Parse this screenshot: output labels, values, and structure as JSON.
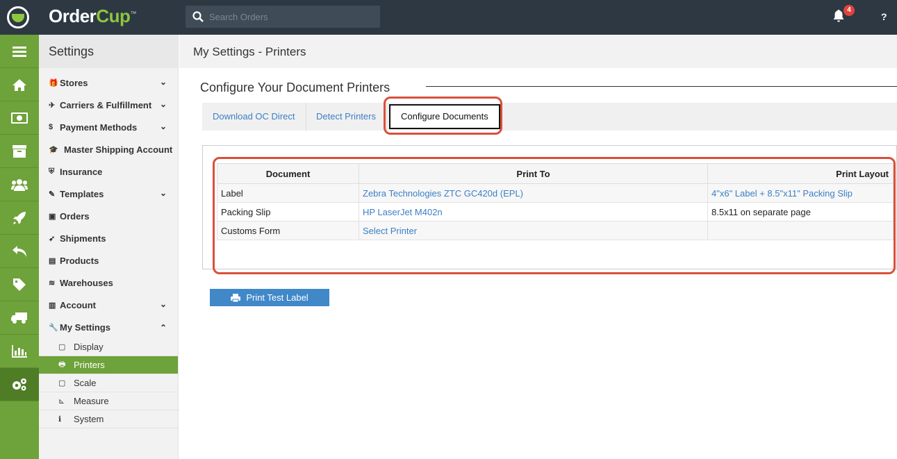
{
  "app": {
    "brand_primary": "Order",
    "brand_secondary": "Cup",
    "trademark": "™"
  },
  "search": {
    "placeholder": "Search Orders"
  },
  "notifications": {
    "count": "4"
  },
  "help": {
    "label": "?"
  },
  "colors": {
    "topbar": "#2d3843",
    "rail": "#6ea23a",
    "accent_blue": "#3b7fc4",
    "badge": "#e2433b",
    "highlight": "#d9503a"
  },
  "rail": {
    "items": [
      "menu-icon",
      "home-icon",
      "money-icon",
      "archive-icon",
      "users-icon",
      "rocket-icon",
      "reply-icon",
      "tag-icon",
      "truck-icon",
      "chart-icon",
      "gears-icon"
    ],
    "active": "gears-icon"
  },
  "settings": {
    "title": "Settings",
    "items": [
      {
        "label": "Stores",
        "icon": "gift-icon",
        "expandable": true
      },
      {
        "label": "Carriers & Fulfillment",
        "icon": "plane-icon",
        "expandable": true
      },
      {
        "label": "Payment Methods",
        "icon": "dollar-icon",
        "expandable": true
      },
      {
        "label": "Master Shipping Account",
        "icon": "graduation-icon",
        "expandable": false
      },
      {
        "label": "Insurance",
        "icon": "shield-icon",
        "expandable": false
      },
      {
        "label": "Templates",
        "icon": "edit-icon",
        "expandable": true
      },
      {
        "label": "Orders",
        "icon": "money-icon",
        "expandable": false
      },
      {
        "label": "Shipments",
        "icon": "rocket-icon",
        "expandable": false
      },
      {
        "label": "Products",
        "icon": "archive-icon",
        "expandable": false
      },
      {
        "label": "Warehouses",
        "icon": "database-icon",
        "expandable": false
      },
      {
        "label": "Account",
        "icon": "briefcase-icon",
        "expandable": true
      },
      {
        "label": "My Settings",
        "icon": "wrench-icon",
        "expandable": true
      }
    ],
    "sub_items": [
      {
        "label": "Display",
        "icon": "square-icon"
      },
      {
        "label": "Printers",
        "icon": "print-icon"
      },
      {
        "label": "Scale",
        "icon": "square-icon"
      },
      {
        "label": "Measure",
        "icon": "ruler-icon"
      },
      {
        "label": "System",
        "icon": "info-icon"
      }
    ],
    "active_sub": "Printers"
  },
  "main": {
    "header": "My Settings - Printers",
    "section_title": "Configure Your Document Printers",
    "tabs": [
      "Download OC Direct",
      "Detect Printers",
      "Configure Documents"
    ],
    "active_tab": "Configure Documents",
    "table": {
      "headers": [
        "Document",
        "Print To",
        "Print Layout"
      ],
      "rows": [
        [
          "Label",
          "Zebra Technologies ZTC GC420d (EPL)",
          "4\"x6\" Label + 8.5\"x11\" Packing Slip"
        ],
        [
          "Packing Slip",
          "HP LaserJet M402n",
          "8.5x11 on separate page"
        ],
        [
          "Customs Form",
          "Select Printer",
          ""
        ]
      ]
    },
    "print_test_label": "Print Test Label"
  }
}
